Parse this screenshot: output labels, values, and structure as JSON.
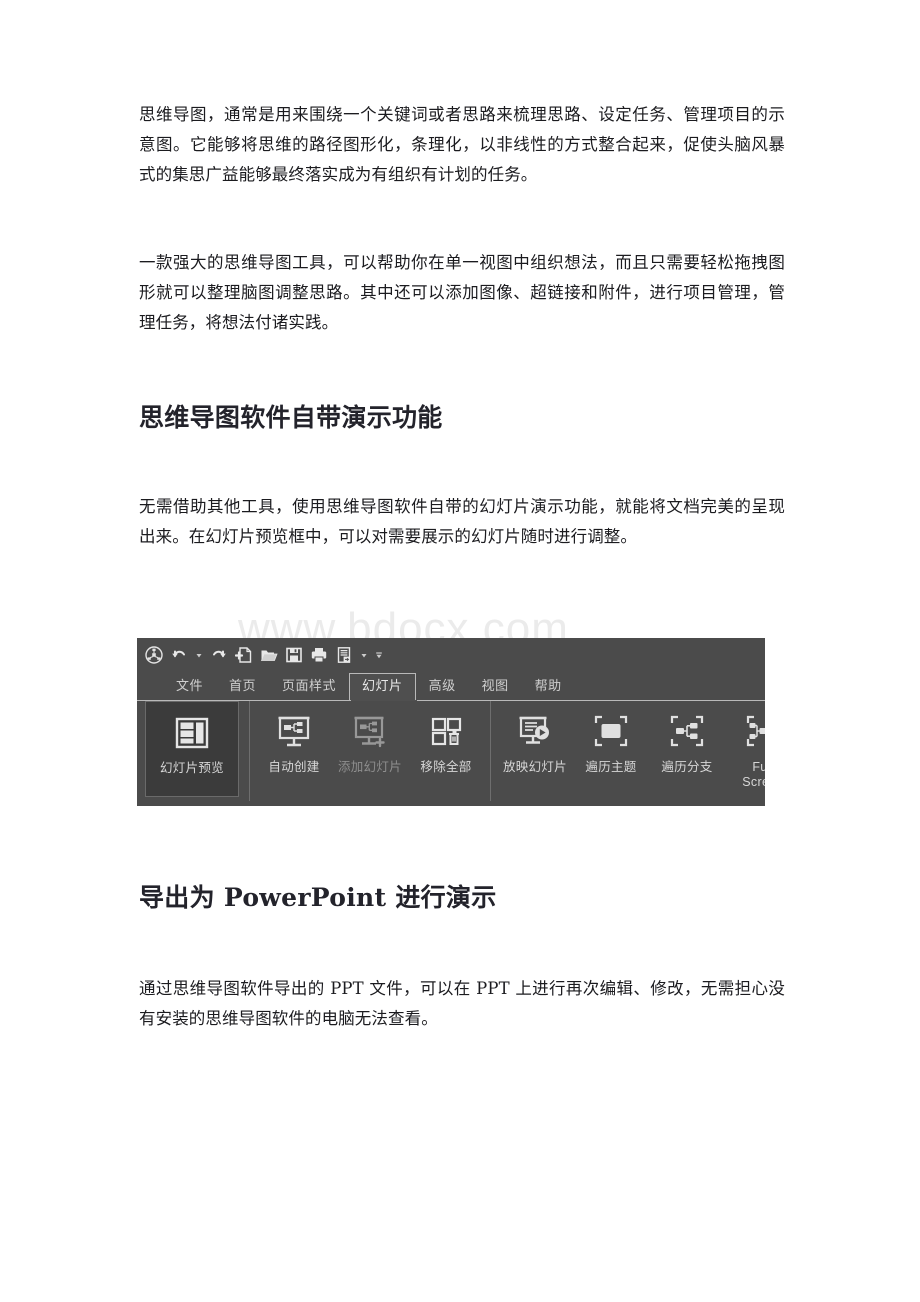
{
  "document": {
    "paragraphs": {
      "p1": "思维导图，通常是用来围绕一个关键词或者思路来梳理思路、设定任务、管理项目的示意图。它能够将思维的路径图形化，条理化，以非线性的方式整合起来，促使头脑风暴式的集思广益能够最终落实成为有组织有计划的任务。",
      "p2": "一款强大的思维导图工具，可以帮助你在单一视图中组织想法，而且只需要轻松拖拽图形就可以整理脑图调整思路。其中还可以添加图像、超链接和附件，进行项目管理，管理任务，将想法付诸实践。",
      "p3": "无需借助其他工具，使用思维导图软件自带的幻灯片演示功能，就能将文档完美的呈现出来。在幻灯片预览框中，可以对需要展示的幻灯片随时进行调整。",
      "p4": "通过思维导图软件导出的 PPT 文件，可以在 PPT 上进行再次编辑、修改，无需担心没有安装的思维导图软件的电脑无法查看。"
    },
    "headings": {
      "h1": "思维导图软件自带演示功能",
      "h2": "导出为 PowerPoint 进行演示"
    },
    "watermark": "www.bdocx.com"
  },
  "ribbon": {
    "quick_access": [
      {
        "name": "app-logo-icon",
        "label": "应用程序"
      },
      {
        "name": "undo-icon",
        "label": "撤销"
      },
      {
        "name": "undo-dropdown-caret-icon",
        "label": "撤销下拉"
      },
      {
        "name": "redo-icon",
        "label": "重做"
      },
      {
        "name": "new-document-icon",
        "label": "新建"
      },
      {
        "name": "open-folder-icon",
        "label": "打开"
      },
      {
        "name": "save-icon",
        "label": "保存"
      },
      {
        "name": "print-icon",
        "label": "打印"
      },
      {
        "name": "export-icon",
        "label": "导出"
      },
      {
        "name": "export-dropdown-caret-icon",
        "label": "导出下拉"
      },
      {
        "name": "customize-toolbar-caret-icon",
        "label": "自定义工具栏"
      }
    ],
    "tabs": [
      {
        "label": "文件",
        "active": false
      },
      {
        "label": "首页",
        "active": false
      },
      {
        "label": "页面样式",
        "active": false
      },
      {
        "label": "幻灯片",
        "active": true
      },
      {
        "label": "高级",
        "active": false
      },
      {
        "label": "视图",
        "active": false
      },
      {
        "label": "帮助",
        "active": false
      }
    ],
    "buttons": [
      {
        "label": "幻灯片预览",
        "icon": "slide-preview-icon",
        "state": "pressed"
      },
      {
        "label": "自动创建",
        "icon": "auto-create-slides-icon",
        "state": "normal"
      },
      {
        "label": "添加幻灯片",
        "icon": "add-slide-icon",
        "state": "disabled"
      },
      {
        "label": "移除全部",
        "icon": "remove-all-slides-icon",
        "state": "normal"
      },
      {
        "label": "放映幻灯片",
        "icon": "play-slideshow-icon",
        "state": "normal"
      },
      {
        "label": "遍历主题",
        "icon": "traverse-topic-icon",
        "state": "normal"
      },
      {
        "label": "遍历分支",
        "icon": "traverse-branch-icon",
        "state": "normal"
      },
      {
        "label": "Full Screen",
        "icon": "full-screen-icon",
        "state": "normal"
      }
    ],
    "colors": {
      "ribbon_background": "#4b4b4b",
      "pressed_background": "#3b3b3b",
      "label_text": "#d7d7d7",
      "disabled_text": "#8e8e8e",
      "separator": "#6e6e6e",
      "active_tab_border": "#b9b9b9"
    }
  }
}
